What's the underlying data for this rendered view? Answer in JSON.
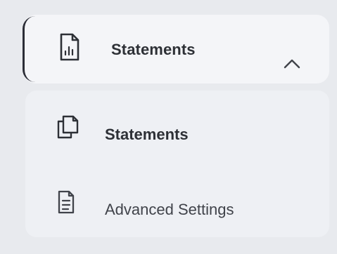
{
  "menu": {
    "header": {
      "label": "Statements",
      "icon": "document-chart-icon",
      "expanded": true,
      "chevron": "chevron-up-icon"
    },
    "items": [
      {
        "label": "Statements",
        "icon": "copy-document-icon",
        "active": true
      },
      {
        "label": "Advanced Settings",
        "icon": "document-lines-icon",
        "active": false
      }
    ]
  },
  "colors": {
    "background": "#e8eaee",
    "header_bg": "#f4f5f8",
    "submenu_bg": "#eef0f4",
    "text_primary": "#2d3036",
    "text_secondary": "#40434a",
    "accent": "#2b2d36"
  }
}
